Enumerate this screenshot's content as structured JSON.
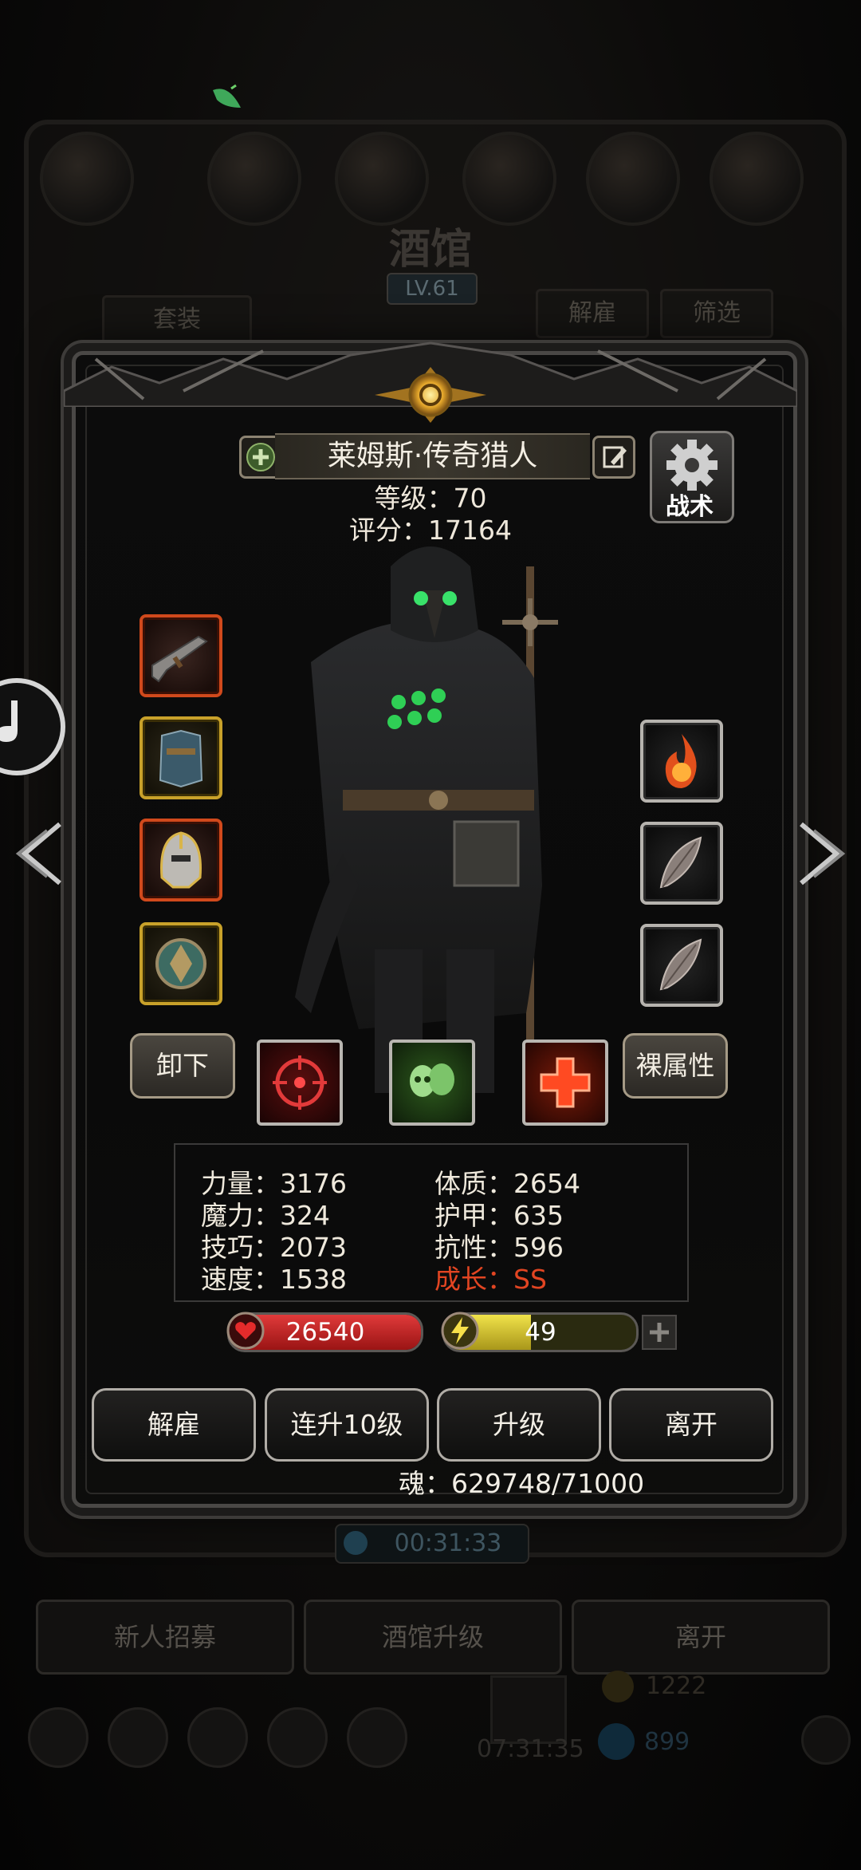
{
  "background": {
    "title": "酒馆",
    "level": "LV.61",
    "suit_tab": "套装",
    "dismiss_tab": "解雇",
    "filter_tab": "筛选",
    "timer": "00:31:33",
    "bottom_buttons": [
      "新人招募",
      "酒馆升级",
      "离开"
    ],
    "dock_timer": "07:31:35",
    "dock_gold": "1222",
    "dock_gems": "899"
  },
  "hero": {
    "name": "莱姆斯·传奇猎人",
    "level_label": "等级：70",
    "score_label": "评分：17164",
    "tactics_label": "战术"
  },
  "equipment": {
    "left_slots": [
      "rifle-icon",
      "armor-icon",
      "helmet-icon",
      "shield-icon"
    ],
    "right_slots": [
      "fire-orb-icon",
      "feather-icon",
      "feather-icon"
    ]
  },
  "controls": {
    "unequip": "卸下",
    "bare_attributes": "裸属性"
  },
  "skills": [
    "crosshair-skill-icon",
    "skulls-skill-icon",
    "cross-skill-icon"
  ],
  "stats": {
    "strength": "力量：3176",
    "magic": "魔力：324",
    "skill": "技巧：2073",
    "speed": "速度：1538",
    "constitution": "体质：2654",
    "armor": "护甲：635",
    "resistance": "抗性：596",
    "growth_label": "成长：",
    "growth_value": "SS"
  },
  "bars": {
    "hp": "26540",
    "energy": "49",
    "hp_fill": 1.0,
    "energy_fill": 0.45
  },
  "actions": {
    "dismiss": "解雇",
    "level_up_10": "连升10级",
    "level_up": "升级",
    "leave": "离开"
  },
  "soul": "魂：629748/71000",
  "colors": {
    "accent_gold": "#c8a12a",
    "accent_orange": "#d0491c",
    "hp_red": "#c51f1f",
    "energy_yellow": "#d8c72a",
    "growth_red": "#e24522"
  }
}
